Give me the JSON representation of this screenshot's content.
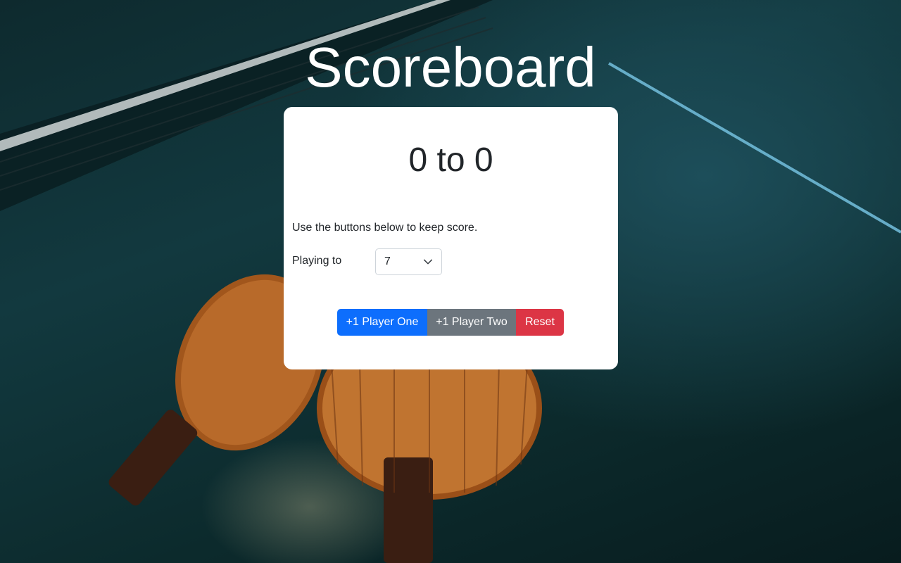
{
  "page": {
    "title": "Scoreboard"
  },
  "scoreboard": {
    "score_text": "0 to 0",
    "instructions": "Use the buttons below to keep score.",
    "playing_to_label": "Playing to",
    "playing_to_value": "7"
  },
  "buttons": {
    "player_one": "+1 Player One",
    "player_two": "+1 Player Two",
    "reset": "Reset"
  },
  "colors": {
    "player_one_button": "#0d6efd",
    "player_two_button": "#6c757d",
    "reset_button": "#dc3545",
    "card_background": "#ffffff",
    "title_text": "#ffffff"
  }
}
